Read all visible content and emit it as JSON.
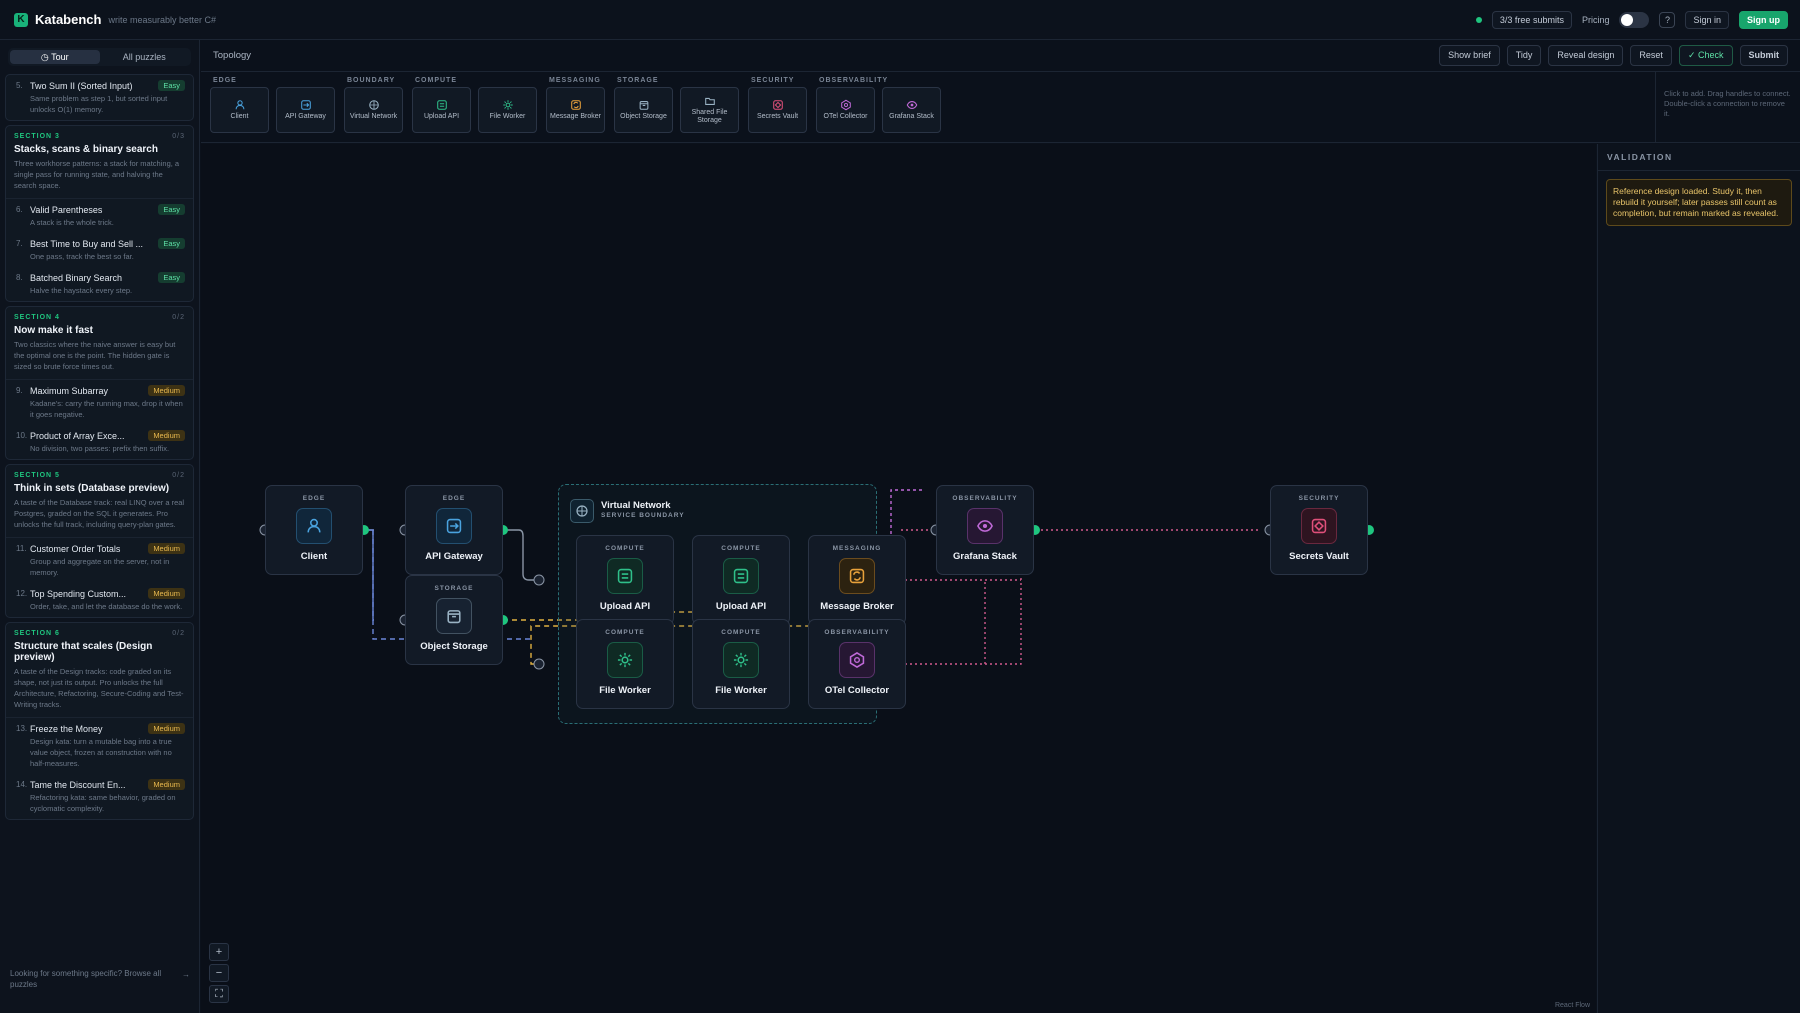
{
  "app": {
    "brand": "Katabench",
    "tagline": "write measurably better C#",
    "free_submits": "3/3 free submits",
    "pricing": "Pricing",
    "help": "?",
    "sign_in": "Sign in",
    "sign_up": "Sign up"
  },
  "sidebar": {
    "tabs": [
      {
        "label": "Tour",
        "active": true
      },
      {
        "label": "All puzzles",
        "active": false
      }
    ],
    "top_item": {
      "num": "5.",
      "name": "Two Sum II (Sorted Input)",
      "badge": "Easy",
      "desc": "Same problem as step 1, but sorted input unlocks O(1) memory."
    },
    "sections": [
      {
        "label": "SECTION 3",
        "count": "0/3",
        "title": "Stacks, scans & binary search",
        "desc": "Three workhorse patterns: a stack for matching, a single pass for running state, and halving the search space.",
        "items": [
          {
            "num": "6.",
            "name": "Valid Parentheses",
            "badge": "Easy",
            "desc": "A stack is the whole trick."
          },
          {
            "num": "7.",
            "name": "Best Time to Buy and Sell ...",
            "badge": "Easy",
            "desc": "One pass, track the best so far."
          },
          {
            "num": "8.",
            "name": "Batched Binary Search",
            "badge": "Easy",
            "desc": "Halve the haystack every step."
          }
        ]
      },
      {
        "label": "SECTION 4",
        "count": "0/2",
        "title": "Now make it fast",
        "desc": "Two classics where the naive answer is easy but the optimal one is the point. The hidden gate is sized so brute force times out.",
        "items": [
          {
            "num": "9.",
            "name": "Maximum Subarray",
            "badge": "Medium",
            "desc": "Kadane's: carry the running max, drop it when it goes negative."
          },
          {
            "num": "10.",
            "name": "Product of Array Exce...",
            "badge": "Medium",
            "desc": "No division, two passes: prefix then suffix."
          }
        ]
      },
      {
        "label": "SECTION 5",
        "count": "0/2",
        "title": "Think in sets (Database preview)",
        "desc": "A taste of the Database track: real LINQ over a real Postgres, graded on the SQL it generates. Pro unlocks the full track, including query-plan gates.",
        "items": [
          {
            "num": "11.",
            "name": "Customer Order Totals",
            "badge": "Medium",
            "desc": "Group and aggregate on the server, not in memory."
          },
          {
            "num": "12.",
            "name": "Top Spending Custom...",
            "badge": "Medium",
            "desc": "Order, take, and let the database do the work."
          }
        ]
      },
      {
        "label": "SECTION 6",
        "count": "0/2",
        "title": "Structure that scales (Design preview)",
        "desc": "A taste of the Design tracks: code graded on its shape, not just its output. Pro unlocks the full Architecture, Refactoring, Secure-Coding and Test-Writing tracks.",
        "items": [
          {
            "num": "13.",
            "name": "Freeze the Money",
            "badge": "Medium",
            "desc": "Design kata: turn a mutable bag into a true value object, frozen at construction with no half-measures."
          },
          {
            "num": "14.",
            "name": "Tame the Discount En...",
            "badge": "Medium",
            "desc": "Refactoring kata: same behavior, graded on cyclomatic complexity."
          }
        ]
      }
    ],
    "footer": "Looking for something specific? Browse all puzzles",
    "footer_arrow": "→"
  },
  "main": {
    "title": "Topology",
    "buttons": {
      "brief": "Show brief",
      "tidy": "Tidy",
      "reveal": "Reveal design",
      "reset": "Reset",
      "check": "✓ Check",
      "submit": "Submit"
    },
    "palette": [
      {
        "group": "EDGE",
        "items": [
          {
            "label": "Client",
            "icon": "user-icon"
          },
          {
            "label": "API Gateway",
            "icon": "gateway-icon"
          }
        ]
      },
      {
        "group": "BOUNDARY",
        "items": [
          {
            "label": "Virtual Network",
            "icon": "network-icon"
          }
        ]
      },
      {
        "group": "COMPUTE",
        "items": [
          {
            "label": "Upload API",
            "icon": "api-icon"
          },
          {
            "label": "File Worker",
            "icon": "worker-icon"
          }
        ]
      },
      {
        "group": "MESSAGING",
        "items": [
          {
            "label": "Message Broker",
            "icon": "broker-icon"
          }
        ]
      },
      {
        "group": "STORAGE",
        "items": [
          {
            "label": "Object Storage",
            "icon": "storage-icon"
          },
          {
            "label": "Shared File Storage",
            "icon": "folder-icon"
          }
        ]
      },
      {
        "group": "SECURITY",
        "items": [
          {
            "label": "Secrets Vault",
            "icon": "vault-icon"
          }
        ]
      },
      {
        "group": "OBSERVABILITY",
        "items": [
          {
            "label": "OTel Collector",
            "icon": "collector-icon"
          },
          {
            "label": "Grafana Stack",
            "icon": "eye-icon"
          }
        ]
      }
    ],
    "hint": "Click to add. Drag handles to connect. Double-click a connection to remove it.",
    "group": {
      "title": "Virtual Network",
      "subtitle": "SERVICE BOUNDARY"
    },
    "nodes": {
      "client": {
        "cat": "EDGE",
        "name": "Client"
      },
      "gateway": {
        "cat": "EDGE",
        "name": "API Gateway"
      },
      "storage": {
        "cat": "STORAGE",
        "name": "Object Storage"
      },
      "upload1": {
        "cat": "COMPUTE",
        "name": "Upload API"
      },
      "upload2": {
        "cat": "COMPUTE",
        "name": "Upload API"
      },
      "broker": {
        "cat": "MESSAGING",
        "name": "Message Broker"
      },
      "worker1": {
        "cat": "COMPUTE",
        "name": "File Worker"
      },
      "worker2": {
        "cat": "COMPUTE",
        "name": "File Worker"
      },
      "otel": {
        "cat": "OBSERVABILITY",
        "name": "OTel Collector"
      },
      "grafana": {
        "cat": "OBSERVABILITY",
        "name": "Grafana Stack"
      },
      "vault": {
        "cat": "SECURITY",
        "name": "Secrets Vault"
      }
    },
    "zoom": {
      "in": "+",
      "out": "−",
      "fit": "⛶"
    },
    "attribution": "React Flow"
  },
  "validation": {
    "title": "VALIDATION",
    "message": "Reference design loaded. Study it, then rebuild it yourself; later passes still count as completion, but remain marked as revealed."
  },
  "colors": {
    "accent": "#18a56c",
    "compute": "#2fc08a",
    "messaging": "#e9a23b",
    "observability": "#c06ad8",
    "security": "#e0507a",
    "edge": "#4aa3df"
  }
}
